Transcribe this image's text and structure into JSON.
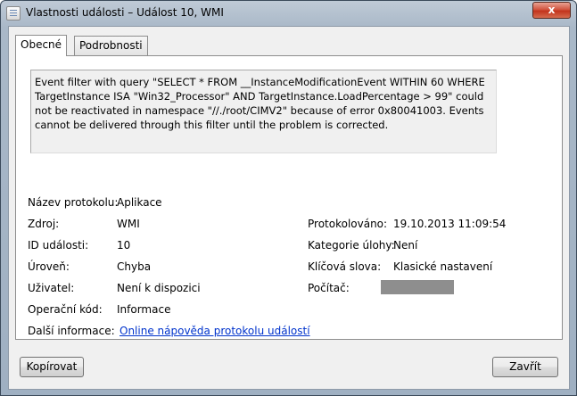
{
  "window": {
    "title": "Vlastnosti události – Událost 10, WMI",
    "close_glyph": "x"
  },
  "tabs": [
    {
      "label": "Obecné"
    },
    {
      "label": "Podrobnosti"
    }
  ],
  "message": "Event filter with query \"SELECT * FROM __InstanceModificationEvent WITHIN 60 WHERE TargetInstance ISA \"Win32_Processor\" AND TargetInstance.LoadPercentage > 99\" could not be reactivated in namespace \"//./root/CIMV2\" because of error 0x80041003. Events cannot be delivered through this filter until the problem is corrected.",
  "fields": {
    "log_name": {
      "label": "Název protokolu:",
      "value": "Aplikace"
    },
    "source": {
      "label": "Zdroj:",
      "value": "WMI"
    },
    "event_id": {
      "label": "ID události:",
      "value": "10"
    },
    "level": {
      "label": "Úroveň:",
      "value": "Chyba"
    },
    "user": {
      "label": "Uživatel:",
      "value": "Není k dispozici"
    },
    "opcode": {
      "label": "Operační kód:",
      "value": "Informace"
    },
    "more_info": {
      "label": "Další informace:",
      "value": "Online nápověda protokolu událostí"
    },
    "logged": {
      "label": "Protokolováno:",
      "value": "19.10.2013 11:09:54"
    },
    "task_category": {
      "label": "Kategorie úlohy:",
      "value": "Není"
    },
    "keywords": {
      "label": "Klíčová slova:",
      "value": "Klasické nastavení"
    },
    "computer": {
      "label": "Počítač:",
      "value_redacted": true
    }
  },
  "buttons": {
    "copy": "Kopírovat",
    "close": "Zavřít"
  },
  "icons": {
    "title": "event-viewer-icon",
    "up": "arrow-up-icon",
    "down": "arrow-down-icon"
  }
}
